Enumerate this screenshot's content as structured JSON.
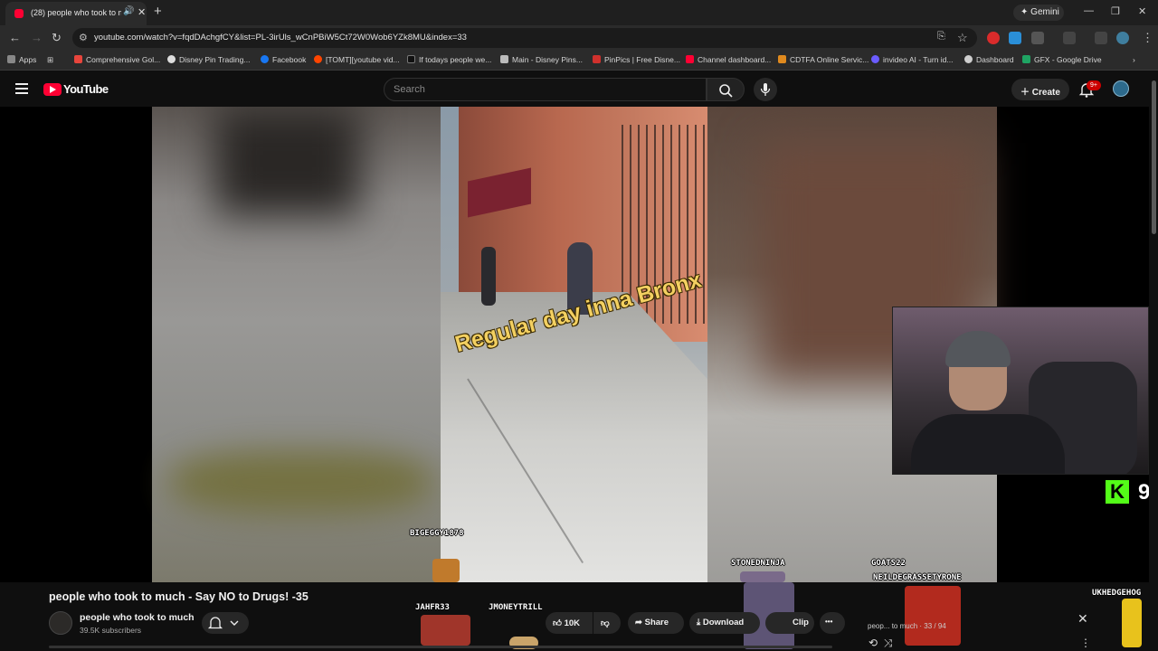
{
  "browser": {
    "tab_title": "(28) people who took to mu...",
    "new_tab_label": "+",
    "gemini_label": "Gemini",
    "url": "youtube.com/watch?v=fqdDAchgfCY&list=PL-3irUls_wCnPBiW5Ct72W0Wob6YZk8MU&index=33"
  },
  "bookmarks": [
    {
      "label": "Apps",
      "color": "#888888"
    },
    {
      "label": "Comprehensive Gol...",
      "color": "#e8453c"
    },
    {
      "label": "Disney Pin Trading...",
      "color": "#dddddd"
    },
    {
      "label": "Facebook",
      "color": "#1877f2"
    },
    {
      "label": "[TOMT][youtube vid...",
      "color": "#ff4500"
    },
    {
      "label": "If todays people we...",
      "color": "#111111"
    },
    {
      "label": "Main - Disney Pins...",
      "color": "#bbbbbb"
    },
    {
      "label": "PinPics | Free Disne...",
      "color": "#d0312d"
    },
    {
      "label": "Channel dashboard...",
      "color": "#ff0033"
    },
    {
      "label": "CDTFA Online Servic...",
      "color": "#e08a1e"
    },
    {
      "label": "invideo AI - Turn id...",
      "color": "#6b5cff"
    },
    {
      "label": "Dashboard",
      "color": "#cfcfcf"
    },
    {
      "label": "GFX - Google Drive",
      "color": "#1fa463"
    }
  ],
  "youtube": {
    "logo_text": "YouTube",
    "search_placeholder": "Search",
    "create_label": "Create",
    "notification_badge": "9+"
  },
  "video": {
    "caption_text": "Regular day inna Bronx",
    "kick_logo": "K",
    "kick_count": "9",
    "overlay_names": [
      "BIGEGGY1878",
      "STONEDNINJA",
      "GOATS22",
      "NEILDEGRASSETYRONE",
      "JAHFR33",
      "JMONEYTRILL",
      "UKHEDGEHOG"
    ]
  },
  "video_info": {
    "title": "people who took to much - Say NO to Drugs! -35",
    "channel_name": "people who took to much",
    "subscribers": "39.5K subscribers",
    "like_count": "10K",
    "share_label": "Share",
    "download_label": "Download",
    "clip_label": "Clip",
    "more_label": "•••"
  },
  "playlist": {
    "title_fragment": "peop... to much",
    "position": "33 / 94"
  }
}
